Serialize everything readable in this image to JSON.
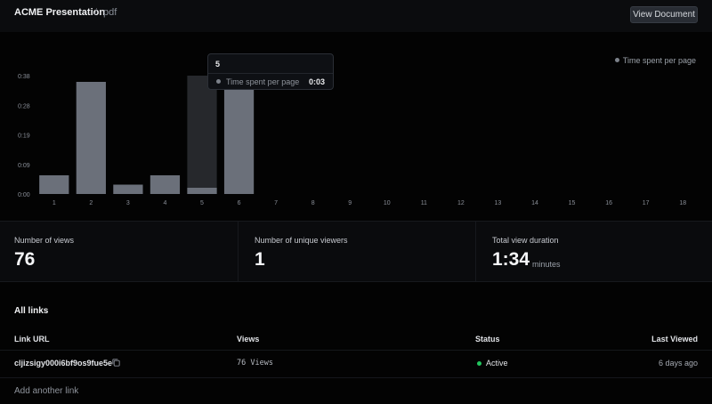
{
  "header": {
    "title": "ACME Presentation",
    "separator": "/",
    "doc_type": "pdf",
    "view_button": "View Document"
  },
  "chart_data": {
    "type": "bar",
    "categories": [
      "1",
      "2",
      "3",
      "4",
      "5",
      "6",
      "7",
      "8",
      "9",
      "10",
      "11",
      "12",
      "13",
      "14",
      "15",
      "16",
      "17",
      "18"
    ],
    "series": [
      {
        "name": "Time spent per page",
        "values": [
          6,
          36,
          3,
          6,
          2,
          35,
          null,
          null,
          null,
          null,
          null,
          null,
          null,
          null,
          null,
          null,
          null,
          null
        ],
        "color": "#6b707a"
      }
    ],
    "y_ticks": [
      "0:00",
      "0:09",
      "0:19",
      "0:28",
      "0:38"
    ],
    "ylim": [
      0,
      38
    ],
    "highlighted_category": "5",
    "legend_position": "top-right",
    "grid": false
  },
  "legend": {
    "label": "Time spent per page"
  },
  "tooltip": {
    "title": "5",
    "label": "Time spent per page",
    "value": "0:03"
  },
  "stats": {
    "views": {
      "label": "Number of views",
      "value": "76"
    },
    "unique": {
      "label": "Number of unique viewers",
      "value": "1"
    },
    "duration": {
      "label": "Total view duration",
      "value": "1:34",
      "unit": "minutes"
    }
  },
  "links": {
    "title": "All links",
    "columns": {
      "url": "Link URL",
      "views": "Views",
      "status": "Status",
      "last_viewed": "Last Viewed"
    },
    "rows": [
      {
        "url": "cljizsigy000i6bf9os9fue5e",
        "views": "76 Views",
        "status": "Active",
        "last_viewed": "6 days ago"
      }
    ],
    "add_link": "Add another link"
  },
  "colors": {
    "background": "#030303",
    "bar": "#6b707a",
    "bar_highlight_bg": "#26282c",
    "status_active": "#22c55e"
  },
  "icons": {
    "copy": "copy-icon",
    "legend_dot": "dot-icon"
  }
}
